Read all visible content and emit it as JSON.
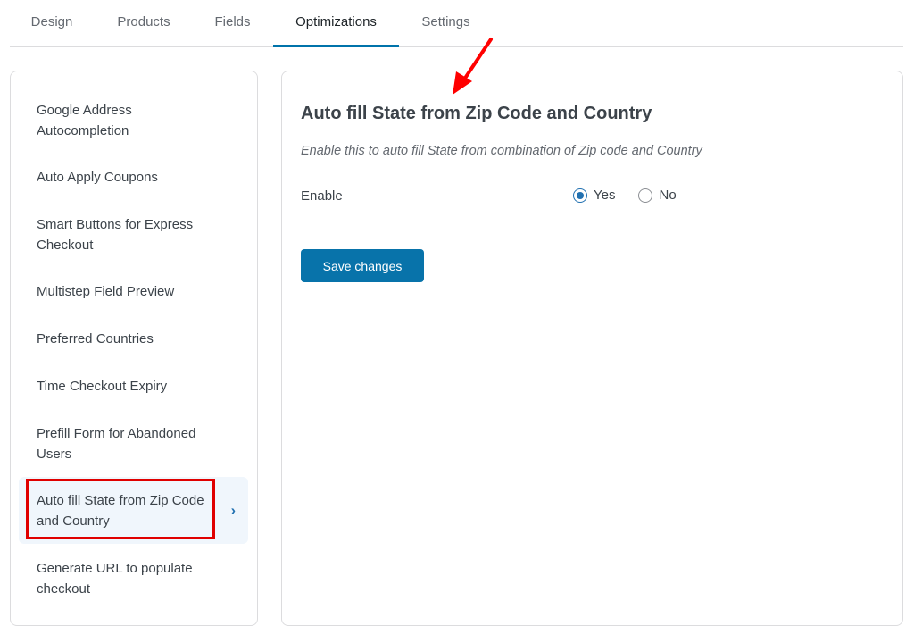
{
  "tabs": [
    {
      "label": "Design",
      "active": false
    },
    {
      "label": "Products",
      "active": false
    },
    {
      "label": "Fields",
      "active": false
    },
    {
      "label": "Optimizations",
      "active": true
    },
    {
      "label": "Settings",
      "active": false
    }
  ],
  "sidebar": {
    "items": [
      {
        "label": "Google Address Autocompletion"
      },
      {
        "label": "Auto Apply Coupons"
      },
      {
        "label": "Smart Buttons for Express Checkout"
      },
      {
        "label": "Multistep Field Preview"
      },
      {
        "label": "Preferred Countries"
      },
      {
        "label": "Time Checkout Expiry"
      },
      {
        "label": "Prefill Form for Abandoned Users"
      },
      {
        "label": "Auto fill State from Zip Code and Country",
        "active": true
      },
      {
        "label": "Generate URL to populate checkout"
      }
    ]
  },
  "panel": {
    "title": "Auto fill State from Zip Code and Country",
    "description": "Enable this to auto fill State from combination of Zip code and Country",
    "enable_label": "Enable",
    "options": [
      {
        "label": "Yes",
        "checked": true
      },
      {
        "label": "No",
        "checked": false
      }
    ],
    "save_label": "Save changes"
  },
  "colors": {
    "accent": "#0073aa",
    "button": "#0873aa",
    "highlight": "#e00000",
    "arrow": "#ff0000",
    "active_item_bg": "#f0f6fc"
  }
}
